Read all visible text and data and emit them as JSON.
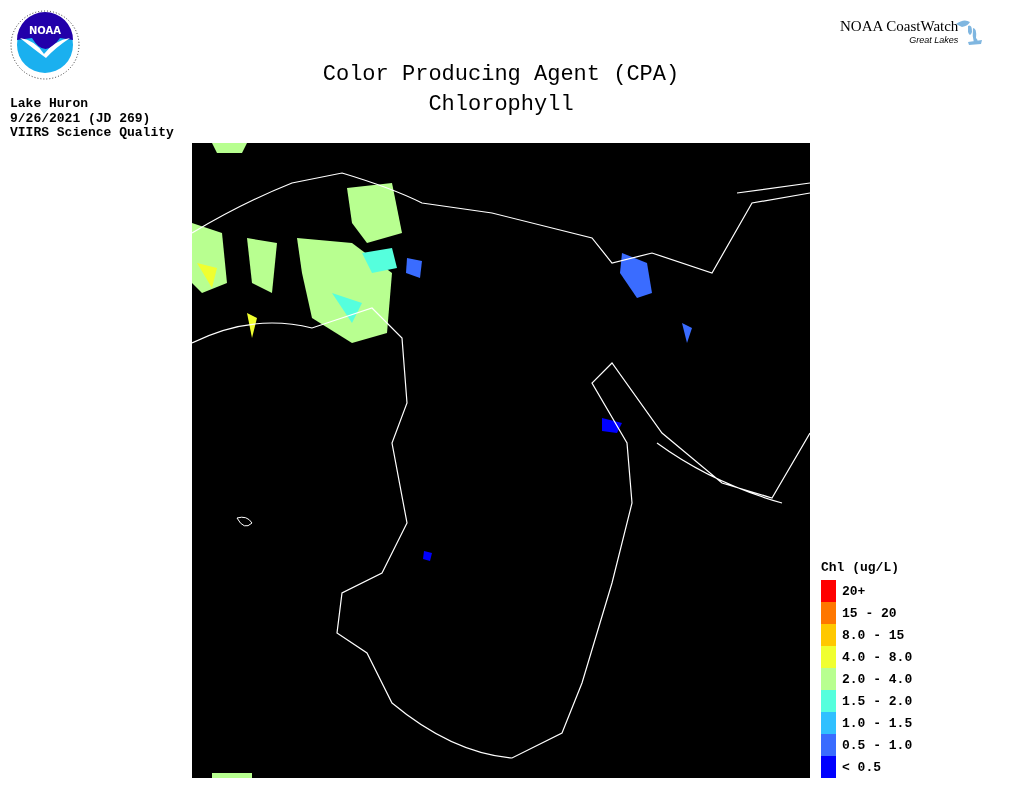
{
  "title": [
    "Color Producing Agent (CPA)",
    "Chlorophyll"
  ],
  "meta": [
    "Lake Huron",
    "9/26/2021 (JD 269)",
    "VIIRS Science Quality"
  ],
  "logo": {
    "agency": "NOAA",
    "brand": "NOAA CoastWatch",
    "region": "Great Lakes"
  },
  "legend": {
    "title": "Chl (ug/L)",
    "items": [
      {
        "label": "20+",
        "color": "#ff0000"
      },
      {
        "label": "15 - 20",
        "color": "#ff7700"
      },
      {
        "label": "8.0 - 15",
        "color": "#ffc800"
      },
      {
        "label": "4.0 - 8.0",
        "color": "#f0ff30"
      },
      {
        "label": "2.0 - 4.0",
        "color": "#b8ff90"
      },
      {
        "label": "1.5 - 2.0",
        "color": "#55ffdd"
      },
      {
        "label": "1.0 - 1.5",
        "color": "#30c0ff"
      },
      {
        "label": "0.5 - 1.0",
        "color": "#3a6cff"
      },
      {
        "label": "< 0.5",
        "color": "#0000ff"
      }
    ]
  }
}
